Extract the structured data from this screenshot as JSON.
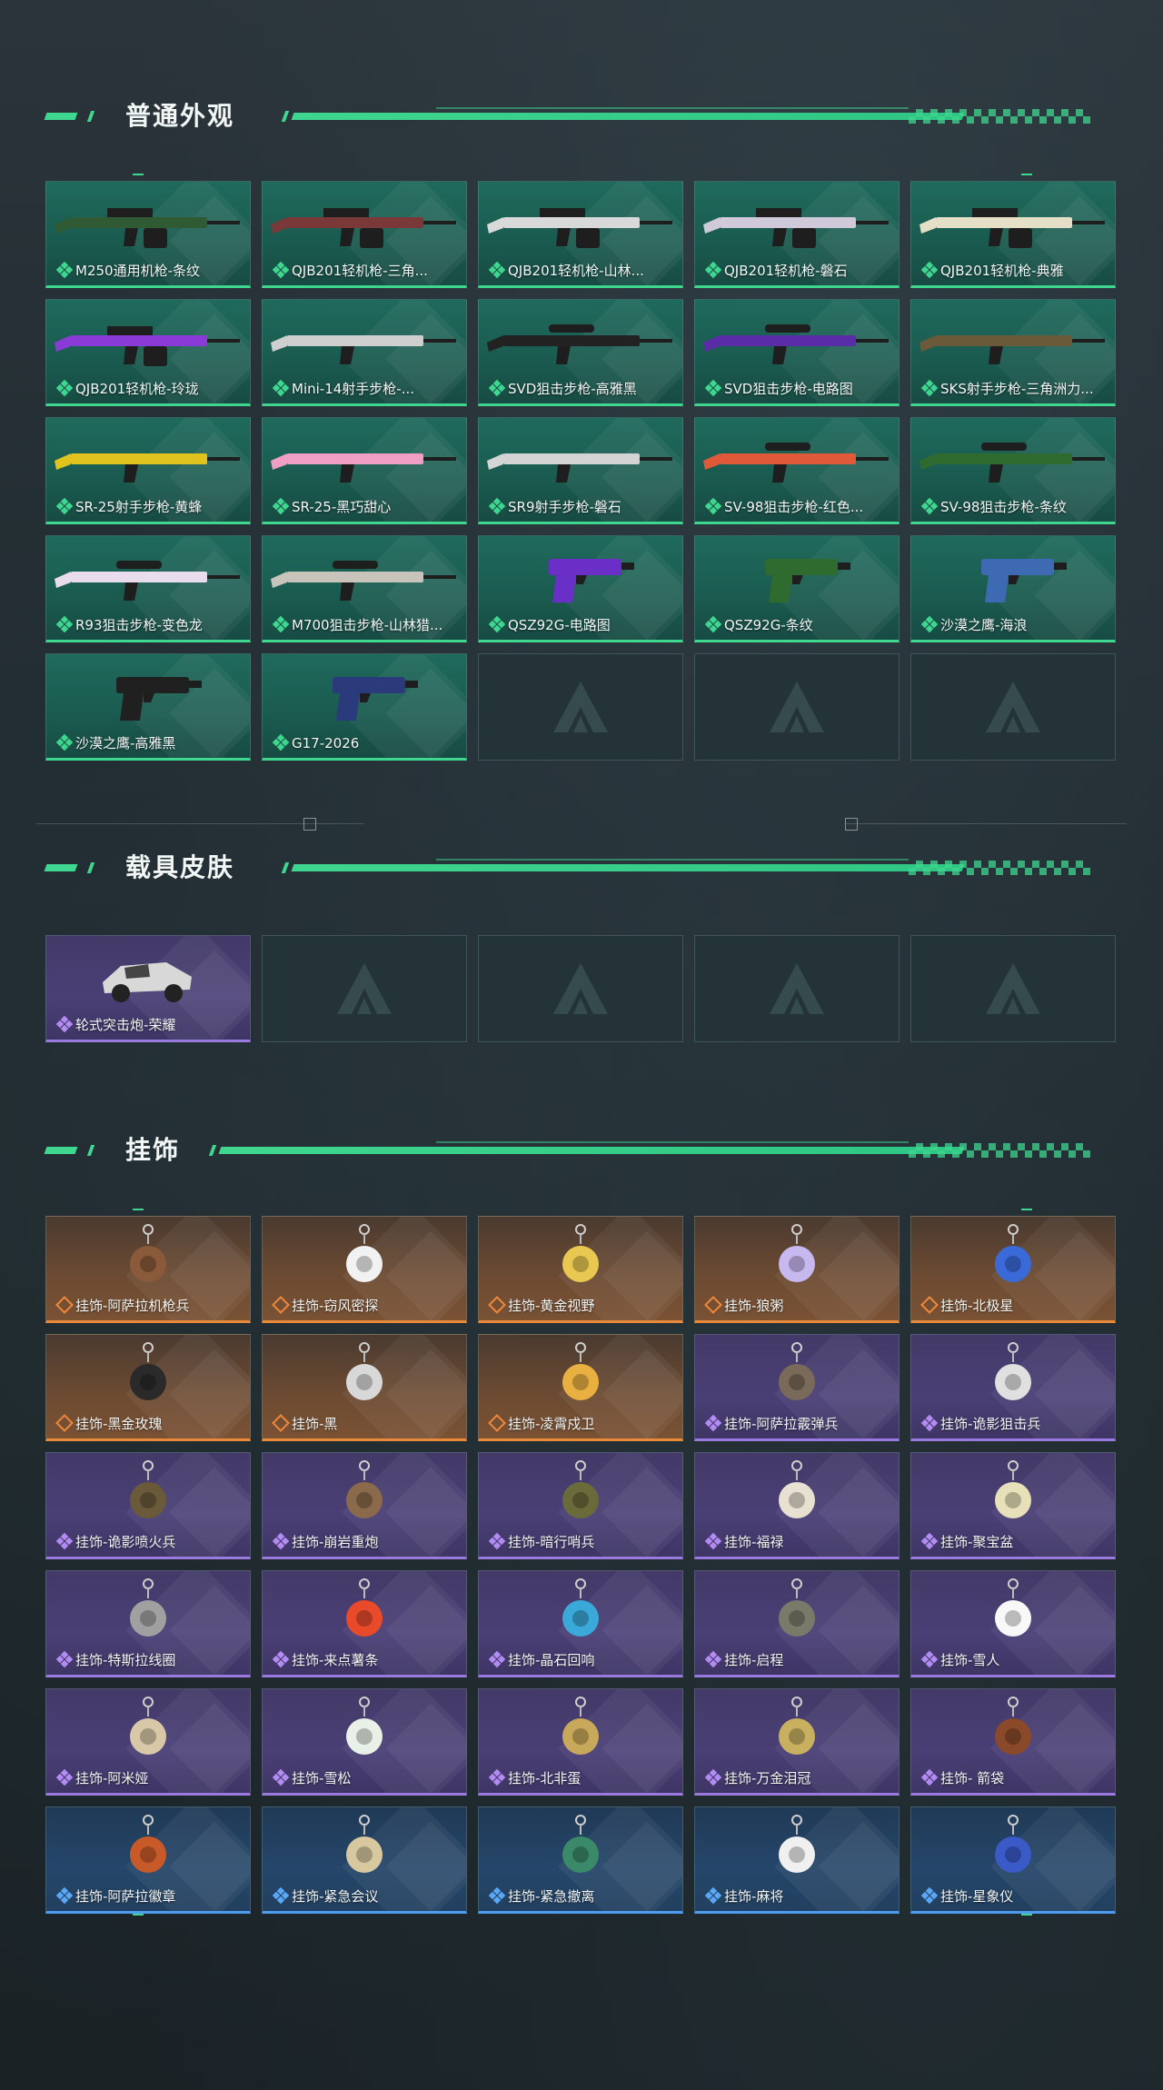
{
  "sections": {
    "weapons": {
      "title": "普通外观",
      "items": [
        {
          "label": "M250通用机枪-条纹",
          "rarity": "green",
          "icon": "machine-gun-icon"
        },
        {
          "label": "QJB201轻机枪-三角...",
          "rarity": "green",
          "icon": "light-machine-gun-icon"
        },
        {
          "label": "QJB201轻机枪-山林...",
          "rarity": "green",
          "icon": "light-machine-gun-icon"
        },
        {
          "label": "QJB201轻机枪-磐石",
          "rarity": "green",
          "icon": "light-machine-gun-icon"
        },
        {
          "label": "QJB201轻机枪-典雅",
          "rarity": "green",
          "icon": "light-machine-gun-icon"
        },
        {
          "label": "QJB201轻机枪-玲珑",
          "rarity": "green",
          "icon": "light-machine-gun-icon"
        },
        {
          "label": "Mini-14射手步枪-...",
          "rarity": "green",
          "icon": "rifle-icon"
        },
        {
          "label": "SVD狙击步枪-高雅黑",
          "rarity": "green",
          "icon": "sniper-rifle-icon"
        },
        {
          "label": "SVD狙击步枪-电路图",
          "rarity": "green",
          "icon": "sniper-rifle-icon"
        },
        {
          "label": "SKS射手步枪-三角洲力...",
          "rarity": "green",
          "icon": "rifle-icon"
        },
        {
          "label": "SR-25射手步枪-黄蜂",
          "rarity": "green",
          "icon": "rifle-icon"
        },
        {
          "label": "SR-25-黑巧甜心",
          "rarity": "green",
          "icon": "rifle-icon"
        },
        {
          "label": "SR9射手步枪-磐石",
          "rarity": "green",
          "icon": "rifle-icon"
        },
        {
          "label": "SV-98狙击步枪-红色...",
          "rarity": "green",
          "icon": "sniper-rifle-icon"
        },
        {
          "label": "SV-98狙击步枪-条纹",
          "rarity": "green",
          "icon": "sniper-rifle-icon"
        },
        {
          "label": "R93狙击步枪-变色龙",
          "rarity": "green",
          "icon": "sniper-rifle-icon"
        },
        {
          "label": "M700狙击步枪-山林猎...",
          "rarity": "green",
          "icon": "sniper-rifle-icon"
        },
        {
          "label": "QSZ92G-电路图",
          "rarity": "green",
          "icon": "pistol-icon"
        },
        {
          "label": "QSZ92G-条纹",
          "rarity": "green",
          "icon": "pistol-icon"
        },
        {
          "label": "沙漠之鹰-海浪",
          "rarity": "green",
          "icon": "pistol-icon"
        },
        {
          "label": "沙漠之鹰-高雅黑",
          "rarity": "green",
          "icon": "pistol-icon"
        },
        {
          "label": "G17-2026",
          "rarity": "green",
          "icon": "pistol-icon"
        }
      ],
      "empty_slots": 3
    },
    "vehicles": {
      "title": "载具皮肤",
      "items": [
        {
          "label": "轮式突击炮-荣耀",
          "rarity": "purple",
          "icon": "armored-vehicle-icon"
        }
      ],
      "empty_slots": 4
    },
    "charms": {
      "title": "挂饰",
      "items": [
        {
          "label": "挂饰-阿萨拉机枪兵",
          "rarity": "orange"
        },
        {
          "label": "挂饰-窃风密探",
          "rarity": "orange"
        },
        {
          "label": "挂饰-黄金视野",
          "rarity": "orange"
        },
        {
          "label": "挂饰-狼粥",
          "rarity": "orange"
        },
        {
          "label": "挂饰-北极星",
          "rarity": "orange"
        },
        {
          "label": "挂饰-黑金玫瑰",
          "rarity": "orange"
        },
        {
          "label": "挂饰-黑",
          "rarity": "orange"
        },
        {
          "label": "挂饰-凌霄戍卫",
          "rarity": "orange"
        },
        {
          "label": "挂饰-阿萨拉霰弹兵",
          "rarity": "purple"
        },
        {
          "label": "挂饰-诡影狙击兵",
          "rarity": "purple"
        },
        {
          "label": "挂饰-诡影喷火兵",
          "rarity": "purple"
        },
        {
          "label": "挂饰-崩岩重炮",
          "rarity": "purple"
        },
        {
          "label": "挂饰-暗行哨兵",
          "rarity": "purple"
        },
        {
          "label": "挂饰-福禄",
          "rarity": "purple"
        },
        {
          "label": "挂饰-聚宝盆",
          "rarity": "purple"
        },
        {
          "label": "挂饰-特斯拉线圈",
          "rarity": "purple"
        },
        {
          "label": "挂饰-来点薯条",
          "rarity": "purple"
        },
        {
          "label": "挂饰-晶石回响",
          "rarity": "purple"
        },
        {
          "label": "挂饰-启程",
          "rarity": "purple"
        },
        {
          "label": "挂饰-雪人",
          "rarity": "purple"
        },
        {
          "label": "挂饰-阿米娅",
          "rarity": "purple"
        },
        {
          "label": "挂饰-雪松",
          "rarity": "purple"
        },
        {
          "label": "挂饰-北非蛋",
          "rarity": "purple"
        },
        {
          "label": "挂饰-万金泪冠",
          "rarity": "purple"
        },
        {
          "label": "挂饰- 箭袋",
          "rarity": "purple"
        },
        {
          "label": "挂饰-阿萨拉徽章",
          "rarity": "blue"
        },
        {
          "label": "挂饰-紧急会议",
          "rarity": "blue"
        },
        {
          "label": "挂饰-紧急撤离",
          "rarity": "blue"
        },
        {
          "label": "挂饰-麻将",
          "rarity": "blue"
        },
        {
          "label": "挂饰-星象仪",
          "rarity": "blue"
        }
      ],
      "empty_slots": 0
    }
  },
  "colors": {
    "accent": "#3fd68f",
    "green": "#3fd68f",
    "purple": "#9b7ae0",
    "orange": "#e98a3b",
    "blue": "#4d9cf0"
  }
}
